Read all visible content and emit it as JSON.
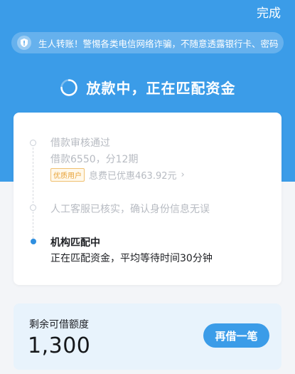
{
  "header": {
    "done_label": "完成"
  },
  "notice": {
    "icon": "shield-icon",
    "text": "生人转账！警惕各类电信网络诈骗，不随意透露银行卡、密码"
  },
  "status": {
    "icon": "loading-spinner-icon",
    "text": "放款中，正在匹配资金"
  },
  "timeline": {
    "steps": [
      {
        "title": "借款审核通过",
        "detail": "借款6550，分12期",
        "badge": "优质用户",
        "discount": "息费已优惠463.92元",
        "state": "done"
      },
      {
        "title": "人工客服已核实，确认身份信息无误",
        "state": "done"
      },
      {
        "title": "机构匹配中",
        "detail": "正在匹配资金，平均等待时间30分钟",
        "state": "active"
      }
    ]
  },
  "quota": {
    "label": "剩余可借额度",
    "value": "1,300",
    "button_label": "再借一笔"
  },
  "colors": {
    "primary": "#3b9ce8",
    "badge": "#e8a33a",
    "muted": "#b7bbc2"
  }
}
